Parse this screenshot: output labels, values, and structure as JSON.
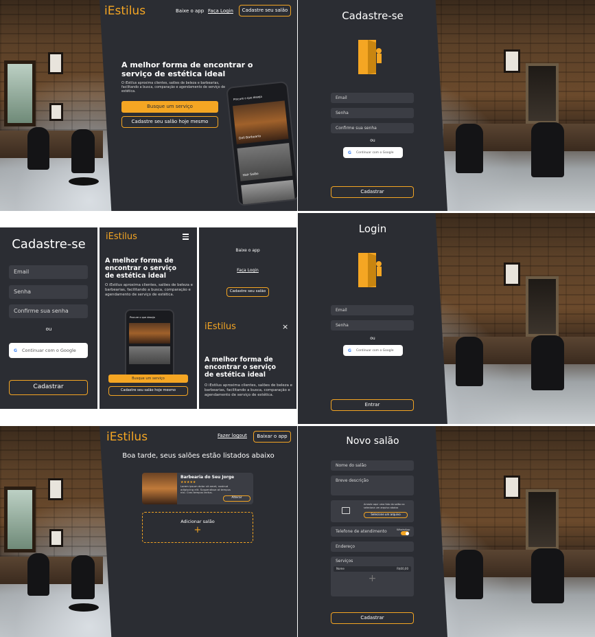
{
  "brand": "iEstilus",
  "colors": {
    "accent": "#f5a623",
    "panel": "#2b2d33",
    "field": "#3b3d44"
  },
  "landing": {
    "nav_app": "Baixe o app",
    "nav_login": "Faça Login",
    "nav_register_salon": "Cadastre seu salão",
    "headline": "A melhor forma de encontrar o serviço de estética ideal",
    "description": "O iEstilus aproxima clientes, salões de beleza e barbearias, facilitando a busca, comparação e agendamento de serviço de estética.",
    "cta_search": "Busque um serviço",
    "cta_register": "Cadastre seu salão hoje mesmo",
    "phone_search": "Procure o que deseja",
    "phone_card1": "Dell Barbearia",
    "phone_card2": "Hair Salão"
  },
  "signup": {
    "title": "Cadastre-se",
    "email": "Email",
    "password": "Senha",
    "confirm": "Confirme sua senha",
    "or": "ou",
    "google": "Continuar com o Google",
    "submit": "Cadastrar"
  },
  "mobile_menu": {
    "app": "Baixe o app",
    "login": "Faça Login",
    "register": "Cadastre seu salão",
    "menu_icon": "hamburger-icon",
    "close_icon": "close-icon"
  },
  "login": {
    "title": "Login",
    "email": "Email",
    "password": "Senha",
    "or": "ou",
    "google": "Continuar com o Google",
    "submit": "Entrar"
  },
  "dashboard": {
    "logout": "Fazer logout",
    "app": "Baixar o app",
    "greeting": "Boa tarde, seus salões estão listados abaixo",
    "salon_name": "Barbearia do Seu Jorge",
    "salon_stars": "★★★★★",
    "salon_desc": "Lorem ipsum dolor sit amet, nostrud adipiscing elit. Suspendisse at tempus nisl. Cras tempus lectus.",
    "salon_edit": "Alterar",
    "add_label": "Adicionar salão",
    "add_plus": "+"
  },
  "new_salon": {
    "title": "Novo salão",
    "name": "Nome do salão",
    "desc": "Breve descrição",
    "photo_hint": "Arraste aqui uma foto do salão na seleciona um arquivo abaixo",
    "photo_button": "Selecione um arquivo",
    "phone": "Telefone de atendimento",
    "whatsapp": "WhatsApp",
    "address": "Endereço",
    "services": "Serviços",
    "service_name": "Nome",
    "service_price": "R$00,00",
    "add_service": "+",
    "submit": "Cadastrar"
  }
}
